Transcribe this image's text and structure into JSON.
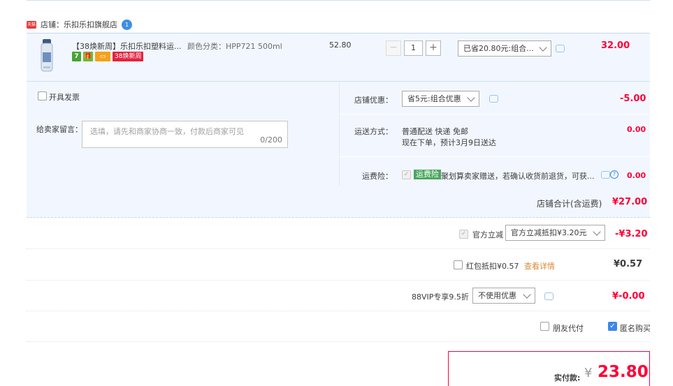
{
  "shop": {
    "badge": "天猫",
    "label": "店铺：乐扣乐扣旗舰店",
    "ww_icon": "1"
  },
  "item": {
    "title": "【38焕新周】乐扣乐扣塑料运...",
    "sku": "颜色分类：HPP721 500ml",
    "tags": [
      "7",
      "🎁",
      "▭",
      "38焕新周"
    ],
    "unit_price": "52.80",
    "quantity": "1",
    "qty_minus": "−",
    "qty_plus": "+",
    "promo_select": "已省20.80元:组合...",
    "total": "32.00"
  },
  "options": {
    "invoice_label": "开具发票",
    "message_label": "给卖家留言：",
    "message_placeholder": "选填，请先和商家协商一致，付款后商家可见",
    "message_count": "0/200",
    "shop_discount_label": "店铺优惠：",
    "shop_discount_select": "省5元:组合优惠",
    "shop_discount_value": "-5.00",
    "delivery_label": "运送方式：",
    "delivery_method": "普通配送 快递 免邮",
    "delivery_eta": "现在下单，预计3月9日送达",
    "delivery_fee": "0.00",
    "insurance_label": "运费险：",
    "insurance_tag": "运费险",
    "insurance_desc": "聚划算卖家赠送，若确认收货前退货，可获...",
    "insurance_value": "0.00"
  },
  "shop_total": {
    "label": "店铺合计(含运费)",
    "value": "¥27.00"
  },
  "order": {
    "official_label": "官方立减",
    "official_select": "官方立减抵扣¥3.20元",
    "official_value": "-¥3.20",
    "redpacket_label": "红包抵扣¥0.57",
    "redpacket_link": "查看详情",
    "redpacket_value": "¥0.57",
    "vip_label": "88VIP专享9.5折",
    "vip_select": "不使用优惠",
    "vip_value": "¥-0.00",
    "friend_pay": "朋友代付",
    "anonymous": "匿名购买"
  },
  "payment": {
    "label": "实付款:",
    "currency": "¥",
    "amount": "23.80"
  },
  "colors": {
    "accent_red": "#ff0036",
    "bg_blue": "#f2f7ff",
    "checkbox_blue": "#3c88e8"
  }
}
